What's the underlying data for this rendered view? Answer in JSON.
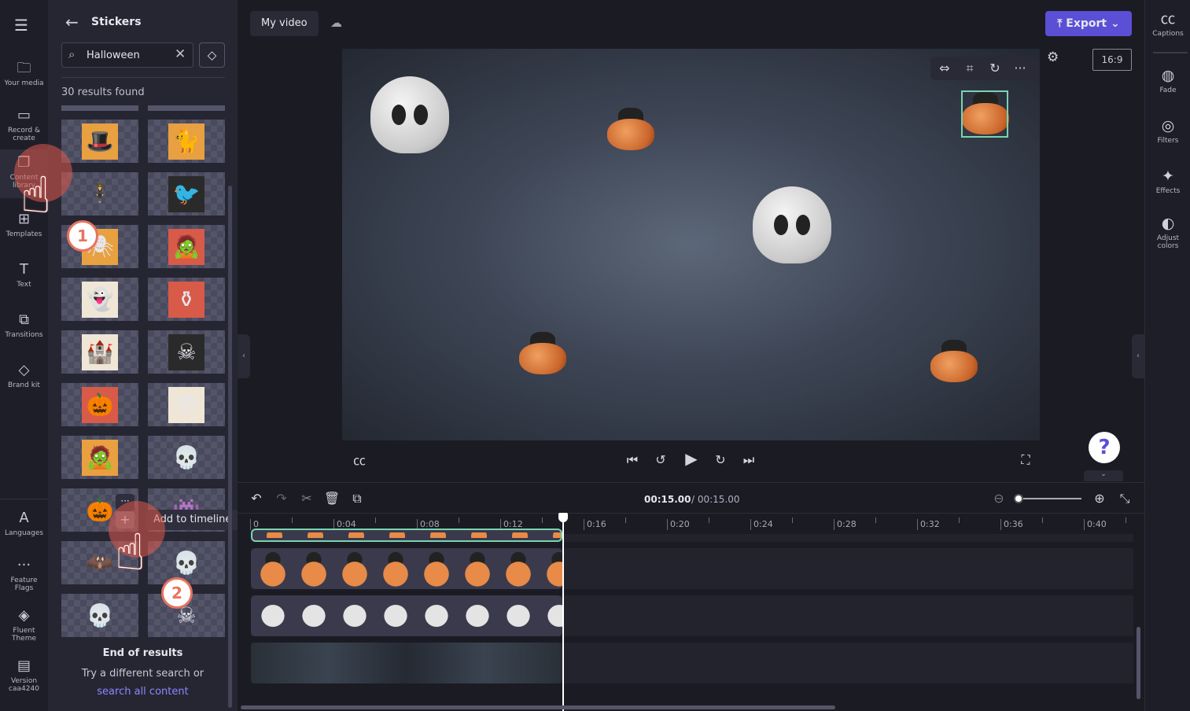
{
  "nav": {
    "items": [
      {
        "label": "Your media",
        "icon": "folder-icon",
        "glyph": "🗀"
      },
      {
        "label": "Record & create",
        "icon": "camera-icon",
        "glyph": "▭"
      },
      {
        "label": "Content library",
        "icon": "content-library-icon",
        "glyph": "❐",
        "active": true
      },
      {
        "label": "Templates",
        "icon": "templates-icon",
        "glyph": "⊞"
      },
      {
        "label": "Text",
        "icon": "text-icon",
        "glyph": "T"
      },
      {
        "label": "Transitions",
        "icon": "transitions-icon",
        "glyph": "⧉"
      },
      {
        "label": "Brand kit",
        "icon": "brand-kit-icon",
        "glyph": "◇"
      }
    ],
    "bottom": [
      {
        "label": "Languages",
        "icon": "languages-icon",
        "glyph": "A"
      },
      {
        "label": "Feature Flags",
        "icon": "more-icon",
        "glyph": "···"
      },
      {
        "label": "Fluent Theme",
        "icon": "paint-bucket-icon",
        "glyph": "◈"
      },
      {
        "label": "Version caa4240",
        "icon": "archive-icon",
        "glyph": "▤"
      }
    ]
  },
  "panel": {
    "title": "Stickers",
    "search_value": "Halloween",
    "results": "30 results found",
    "stickers": [
      {
        "name": "witch-hat",
        "glyph": "🎩",
        "bg": "#e8a040"
      },
      {
        "name": "black-cat",
        "glyph": "🐈",
        "bg": "#e8a040"
      },
      {
        "name": "scarecrow",
        "glyph": "🕴",
        "bg": ""
      },
      {
        "name": "raven",
        "glyph": "🐦",
        "bg": "#2a2a2a"
      },
      {
        "name": "spider",
        "glyph": "🕷",
        "bg": "#e8a040"
      },
      {
        "name": "mummy",
        "glyph": "🧟",
        "bg": "#d85a48"
      },
      {
        "name": "ghost",
        "glyph": "👻",
        "bg": "#efe6d6"
      },
      {
        "name": "cauldron",
        "glyph": "⚱",
        "bg": "#d85a48"
      },
      {
        "name": "haunted-house",
        "glyph": "🏰",
        "bg": "#efe6d6"
      },
      {
        "name": "skull-crossbones",
        "glyph": "☠",
        "bg": "#2a2a2a"
      },
      {
        "name": "jack-o-lantern",
        "glyph": "🎃",
        "bg": "#d85a48"
      },
      {
        "name": "eyeball",
        "glyph": "👁",
        "bg": "#efe6d6"
      },
      {
        "name": "frankenstein",
        "glyph": "🧟",
        "bg": "#e8a040"
      },
      {
        "name": "3d-skull",
        "glyph": "💀",
        "bg": ""
      },
      {
        "name": "cat-pumpkin",
        "glyph": "🎃",
        "bg": ""
      },
      {
        "name": "purple-ghost",
        "glyph": "👾",
        "bg": ""
      },
      {
        "name": "vampire-teeth",
        "glyph": "🦇",
        "bg": ""
      },
      {
        "name": "skull-bow",
        "glyph": "💀",
        "bg": ""
      },
      {
        "name": "green-skull",
        "glyph": "💀",
        "bg": ""
      },
      {
        "name": "melting-skull",
        "glyph": "☠",
        "bg": ""
      }
    ],
    "tooltip": "Add to timeline",
    "end_title": "End of results",
    "end_text": "Try a different search or",
    "end_link": "search all content"
  },
  "header": {
    "project_name": "My video",
    "export_label": "Export",
    "aspect_ratio": "16:9"
  },
  "right": {
    "items": [
      {
        "label": "Captions",
        "icon": "captions-icon",
        "glyph": "㏄"
      },
      {
        "label": "Fade",
        "icon": "fade-icon",
        "glyph": "◍"
      },
      {
        "label": "Filters",
        "icon": "filters-icon",
        "glyph": "◎"
      },
      {
        "label": "Effects",
        "icon": "magic-wand-icon",
        "glyph": "✦"
      },
      {
        "label": "Adjust colors",
        "icon": "adjust-colors-icon",
        "glyph": "◐"
      }
    ]
  },
  "timeline": {
    "current_time": "00:15.00",
    "total_time": "/ 00:15.00",
    "ruler": [
      "0",
      "0:04",
      "0:08",
      "0:12",
      "0:16",
      "0:20",
      "0:24",
      "0:28",
      "0:32",
      "0:36",
      "0:40"
    ],
    "playhead_seconds": 15,
    "zoom_level": 0
  },
  "colors": {
    "accent": "#5b4fd6",
    "link": "#8f86ff",
    "clip_selected": "#7ad3b0",
    "highlight": "#e05a4a"
  }
}
